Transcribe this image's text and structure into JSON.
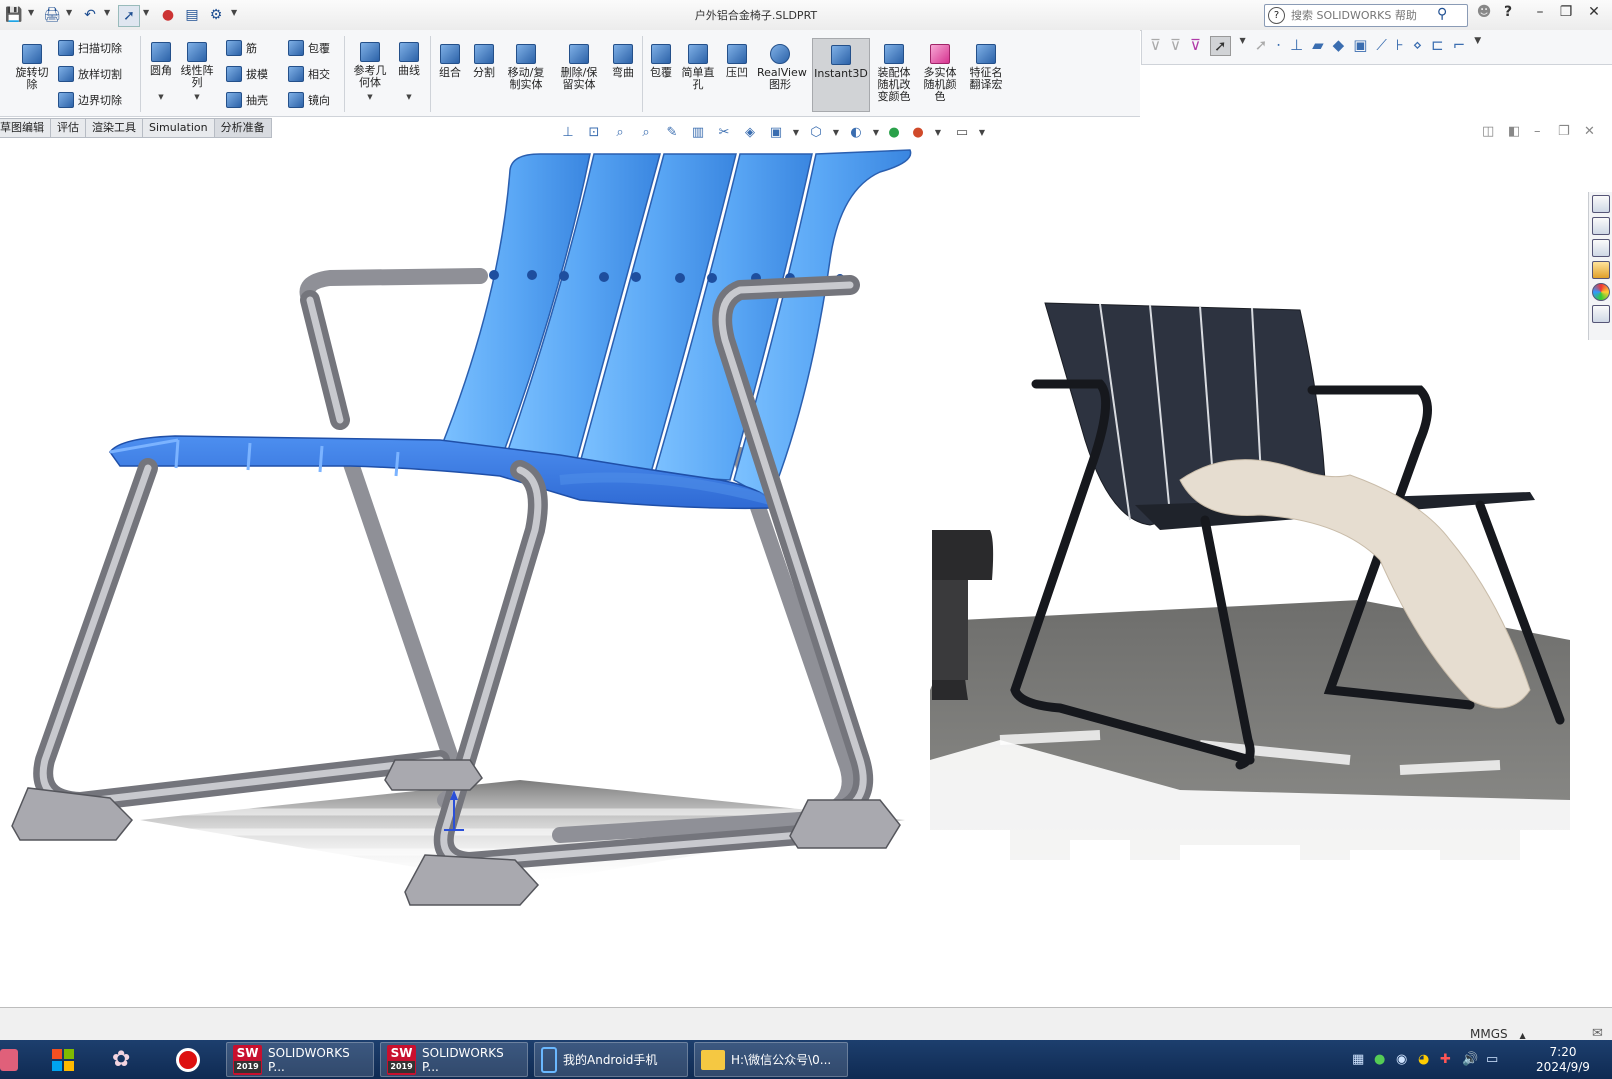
{
  "app": {
    "window_title": "户外铝合金椅子.SLDPRT",
    "search_placeholder": "搜索 SOLIDWORKS 帮助"
  },
  "ribbon": {
    "group1": [
      "旋转切除",
      "扫描切除",
      "放样切割",
      "边界切除"
    ],
    "group2": [
      "圆角",
      "线性阵列",
      "筋",
      "包覆",
      "拔模",
      "相交",
      "抽壳",
      "镜向"
    ],
    "group3": [
      "参考几何体",
      "曲线"
    ],
    "group4": [
      "组合",
      "分割",
      "移动/复制实体",
      "删除/保留实体",
      "弯曲",
      "包覆",
      "简单直孔",
      "压凹",
      "RealView图形",
      "Instant3D",
      "装配体随机改变颜色",
      "多实体随机颜色",
      "特征名翻译宏"
    ]
  },
  "tabs": [
    "草图编辑",
    "评估",
    "渲染工具",
    "Simulation",
    "分析准备"
  ],
  "status": {
    "units": "MMGS"
  },
  "taskbar": {
    "items": [
      "SOLIDWORKS P...",
      "SOLIDWORKS P...",
      "我的Android手机",
      "H:\\微信公众号\\0..."
    ],
    "sw_badge": "2019",
    "sw_letters": "SW",
    "time": "7:20",
    "date": "2024/9/9"
  },
  "colors": {
    "seat_blue": "#5aa7f5",
    "frame_gray": "#9a9aa0",
    "ribbon_bg": "#f6f7f9",
    "taskbar_bg": "#163766"
  },
  "icons": {
    "quick_access": [
      "save-icon",
      "print-icon",
      "undo-icon",
      "select-icon",
      "rebuild-icon",
      "file-properties-icon",
      "options-icon"
    ],
    "right_toolbar": [
      "filter-icon",
      "select-arrow-icon",
      "view-icon",
      "axis-icon",
      "plane-icon"
    ],
    "task_pane": [
      "home-icon",
      "design-library-icon",
      "file-explorer-icon",
      "view-palette-icon",
      "appearances-icon",
      "custom-properties-icon"
    ]
  }
}
